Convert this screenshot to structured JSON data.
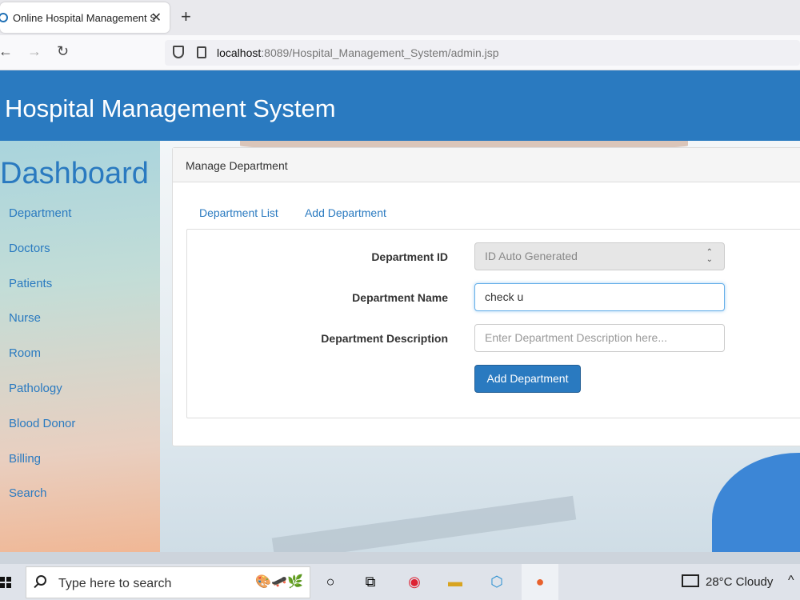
{
  "browser": {
    "tab_title": "Online Hospital Management Sy",
    "tab_close": "✕",
    "new_tab": "+",
    "url_host": "localhost",
    "url_rest": ":8089/Hospital_Management_System/admin.jsp",
    "back": "←",
    "forward": "→",
    "reload": "↻"
  },
  "header": {
    "title": "Hospital Management System"
  },
  "sidebar": {
    "title": "Dashboard",
    "items": [
      "Department",
      "Doctors",
      "Patients",
      "Nurse",
      "Room",
      "Pathology",
      "Blood Donor",
      "Billing",
      "Search"
    ]
  },
  "panel": {
    "heading": "Manage Department",
    "tabs": [
      "Department List",
      "Add Department"
    ],
    "form": {
      "id_label": "Department ID",
      "id_value": "ID Auto Generated",
      "name_label": "Department Name",
      "name_value": "check u",
      "desc_label": "Department Description",
      "desc_placeholder": "Enter Department Description here...",
      "submit_label": "Add Department"
    }
  },
  "taskbar": {
    "search_text": "Type here to search",
    "weather": "28°C  Cloudy",
    "caret": "^"
  },
  "colors": {
    "accent": "#2a7ac0"
  }
}
